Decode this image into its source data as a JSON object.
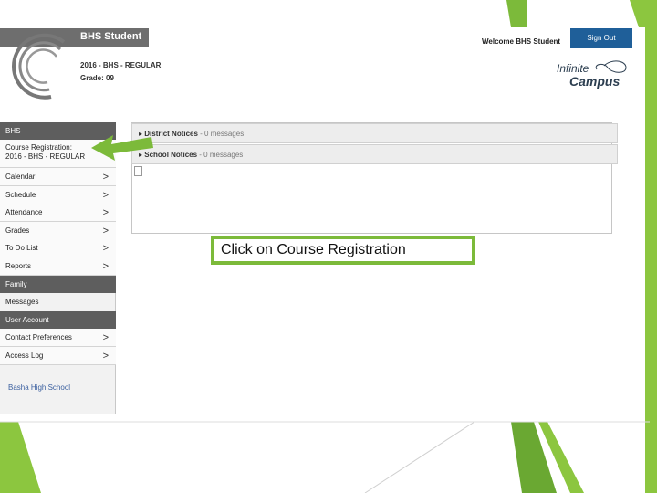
{
  "colors": {
    "slide_accent": "#7cba3a",
    "header_gray": "#6e6e6e",
    "sidebar_section": "#5e5e5e",
    "sign_out_blue": "#1f5f99"
  },
  "header": {
    "app_title": "BHS Student",
    "term": "2016 - BHS - REGULAR",
    "grade": "Grade: 09",
    "welcome": "Welcome BHS Student",
    "sign_out": "Sign Out",
    "brand_line1": "Infinite",
    "brand_line2": "Campus"
  },
  "sidebar": {
    "section_bhs": "BHS",
    "course_registration_line1": "Course Registration:",
    "course_registration_line2": "2016 - BHS - REGULAR",
    "items": [
      {
        "label": "Calendar"
      },
      {
        "label": "Schedule"
      },
      {
        "label": "Attendance"
      },
      {
        "label": "Grades"
      },
      {
        "label": "To Do List"
      },
      {
        "label": "Reports"
      }
    ],
    "section_family": "Family",
    "messages": "Messages",
    "section_user_account": "User Account",
    "account_items": [
      {
        "label": "Contact Preferences"
      },
      {
        "label": "Access Log"
      }
    ],
    "school_name": "Basha High School"
  },
  "notices": {
    "district_title": "District Notices",
    "district_count": "- 0 messages",
    "school_title": "School Notices",
    "school_count": "- 0 messages"
  },
  "callout": {
    "text": "Click on Course Registration"
  }
}
